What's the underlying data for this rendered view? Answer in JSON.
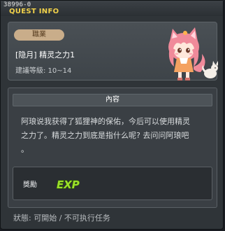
{
  "window": {
    "quest_id": "38996-0",
    "title": "QUEST INFO"
  },
  "header": {
    "job_label": "職業",
    "quest_name": "[隐月] 精灵之力1",
    "recommended_level": "建議等級: 10~14"
  },
  "content": {
    "section_title": "內容",
    "text": "阿琅说我获得了狐狸神的保佑，今后可以使用精灵\n之力了。精灵之力到底是指什么呢? 去问问阿琅吧\n。"
  },
  "reward": {
    "label": "獎勵",
    "exp_text": "EXP",
    "exp_color": "#9be02a"
  },
  "status": {
    "text": "狀態: 可開始 / 不可执行任务"
  },
  "colors": {
    "title_accent": "#f2d24a",
    "job_tag_bg": "#c9ad8a"
  }
}
